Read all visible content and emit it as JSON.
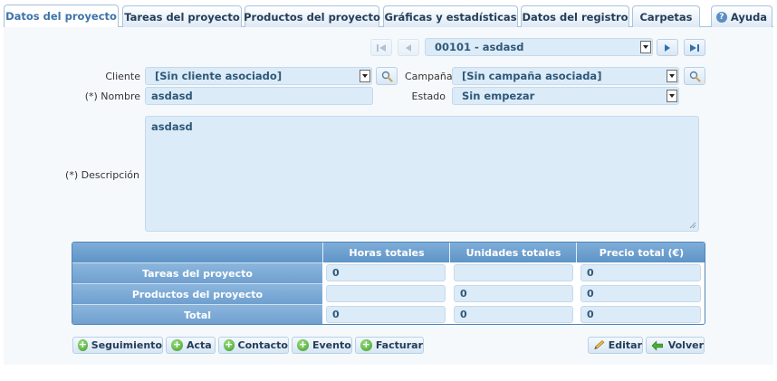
{
  "tabs": [
    {
      "label": "Datos del proyecto",
      "active": true
    },
    {
      "label": "Tareas del proyecto",
      "active": false
    },
    {
      "label": "Productos del proyecto",
      "active": false
    },
    {
      "label": "Gráficas y estadísticas",
      "active": false
    },
    {
      "label": "Datos del registro",
      "active": false
    },
    {
      "label": "Carpetas",
      "active": false
    }
  ],
  "help": {
    "label": "Ayuda",
    "icon": "help-icon"
  },
  "record_nav": {
    "current": "00101 - asdasd",
    "icons": [
      "first-record-icon",
      "previous-record-icon",
      "next-record-icon",
      "last-record-icon"
    ]
  },
  "form": {
    "cliente_label": "Cliente",
    "cliente_value": "[Sin cliente asociado]",
    "campana_label": "Campaña",
    "campana_value": "[Sin campaña asociada]",
    "nombre_label": "(*) Nombre",
    "nombre_value": "asdasd",
    "estado_label": "Estado",
    "estado_value": "Sin empezar",
    "descripcion_label": "(*) Descripción",
    "descripcion_value": "asdasd"
  },
  "totals": {
    "headers": [
      "Horas totales",
      "Unidades totales",
      "Precio total (€)"
    ],
    "rows": [
      {
        "label": "Tareas del proyecto",
        "horas": "0",
        "unidades": "",
        "precio": "0"
      },
      {
        "label": "Productos del proyecto",
        "horas": "",
        "unidades": "0",
        "precio": "0"
      },
      {
        "label": "Total",
        "horas": "0",
        "unidades": "0",
        "precio": "0"
      }
    ]
  },
  "actions": {
    "seguimiento": "Seguimiento",
    "acta": "Acta",
    "contacto": "Contacto",
    "evento": "Evento",
    "facturar": "Facturar",
    "editar": "Editar",
    "volver": "Volver"
  },
  "colors": {
    "accent": "#3d73a7",
    "header": "#5e94c7",
    "field": "#dcebf8",
    "add_green": "#3e9d2a"
  }
}
